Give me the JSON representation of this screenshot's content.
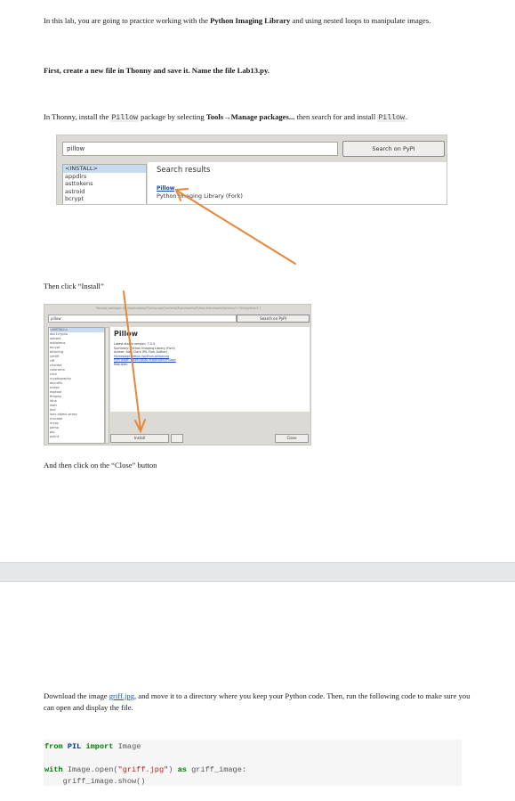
{
  "intro": {
    "text_1": "In this lab, you are going to practice working with the ",
    "library": "Python Imaging Library",
    "text_2": " and using nested loops to manipulate images."
  },
  "step1": "First, create a new file in Thonny and save it. Name the file Lab13.py.",
  "install": {
    "text_1": "In Thonny, install the ",
    "pkg": "Pillow",
    "text_2": " package by selecting ",
    "menu": "Tools→Manage packages...",
    "text_3": " then search for and install ",
    "pkg2": "Pillow",
    "text_4": "."
  },
  "shot1": {
    "search_value": "pillow",
    "search_button": "Search on PyPI",
    "list_items": [
      "<INSTALL>",
      "appdirs",
      "asttokens",
      "astroid",
      "bcrypt"
    ],
    "results_heading": "Search results",
    "result_link": "Pillow",
    "result_desc": "Python Imaging Library (Fork)"
  },
  "step_install": "Then click “Install”",
  "shot2": {
    "title": "Manage packages for /Applications/Thonny.app/Contents/Frameworks/Python.framework/Versions/3.7/bin/python3.7",
    "search_value": "pillow",
    "search_button": "Search on PyPI",
    "list_items": [
      "<INSTALL>",
      "asn1crypto",
      "astroid",
      "asttokens",
      "bcrypt",
      "bitstring",
      "certifi",
      "cffi",
      "chardet",
      "colorama",
      "click",
      "cryptography",
      "docutils",
      "ecdsa",
      "esptool",
      "ffmpeg",
      "idna",
      "isort",
      "jedi",
      "lazy-object-proxy",
      "mccabe",
      "mypy",
      "parso",
      "pip",
      "pylint"
    ],
    "pkg_title": "Pillow",
    "info_lines": [
      "Latest stable version: 7.0.0",
      "Summary: Python Imaging Library (Fork)",
      "Author: Alex Clark (PIL Fork Author)",
      "Homepage: https://python-pillow.org",
      "PyPI page: https://pypi.org/project/Pillow/",
      "Requires:"
    ],
    "install_button": "Install",
    "close_button": "Close"
  },
  "step_close": "And then click on the “Close” button",
  "download": {
    "text_1": "Download the image ",
    "link": "griff.jpg",
    "text_2": ", and move it to a directory where you keep your Python code. Then, run the following code to make sure you can open and display the file."
  },
  "code": {
    "line1": {
      "kw1": "from",
      "mod": "PIL",
      "kw2": "import",
      "name": "Image"
    },
    "line2": {
      "kw1": "with",
      "call": "Image.open(",
      "str": "\"griff.jpg\"",
      "close": ")",
      "kw2": "as",
      "var": "griff_image:"
    },
    "line3": "    griff_image.show()"
  },
  "colors": {
    "arrow": "#e8863a",
    "link": "#1155cc",
    "keyword": "#008000",
    "string": "#ba2121"
  }
}
